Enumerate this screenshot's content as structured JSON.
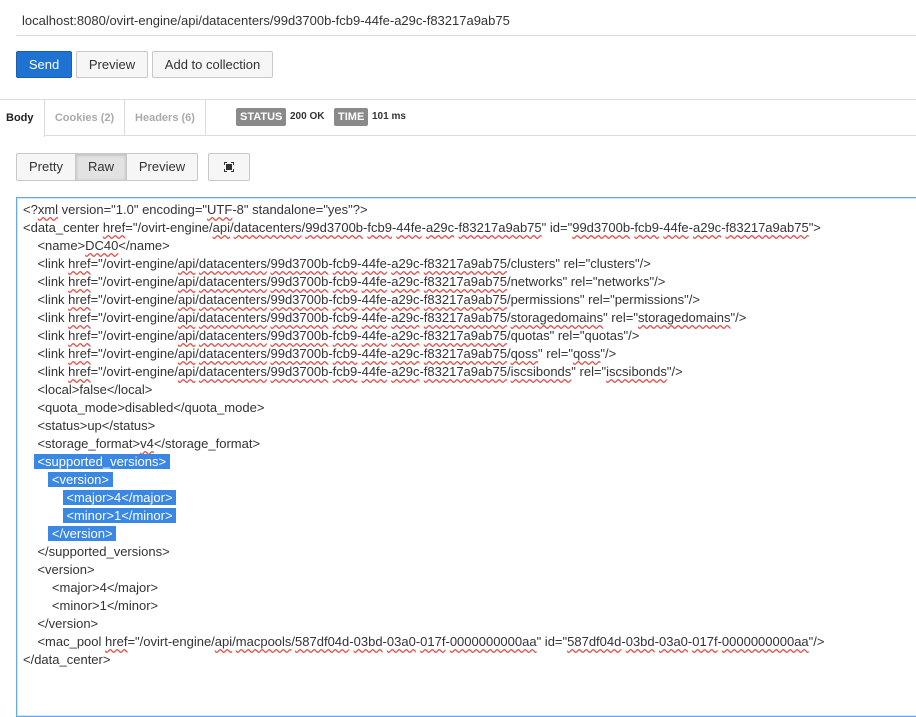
{
  "url": "localhost:8080/ovirt-engine/api/datacenters/99d3700b-fcb9-44fe-a29c-f83217a9ab75",
  "buttons": {
    "send": "Send",
    "preview": "Preview",
    "add_to_collection": "Add to collection"
  },
  "response_tabs": {
    "body": "Body",
    "cookies": "Cookies (2)",
    "headers": "Headers (6)"
  },
  "status": {
    "status_label": "STATUS",
    "status_value": "200 OK",
    "time_label": "TIME",
    "time_value": "101 ms"
  },
  "view_modes": {
    "pretty": "Pretty",
    "raw": "Raw",
    "preview": "Preview",
    "selected": "Raw"
  },
  "icons": {
    "expand": "expand-icon"
  },
  "colors": {
    "send_button": "#1e73d2",
    "selection": "#3a88e3",
    "focus_border": "#66aaee",
    "spell_underline": "#e0504a"
  },
  "body_lines": [
    "<?xml version=\"1.0\" encoding=\"UTF-8\" standalone=\"yes\"?>",
    "<data_center href=\"/ovirt-engine/api/datacenters/99d3700b-fcb9-44fe-a29c-f83217a9ab75\" id=\"99d3700b-fcb9-44fe-a29c-f83217a9ab75\">",
    "    <name>DC40</name>",
    "    <link href=\"/ovirt-engine/api/datacenters/99d3700b-fcb9-44fe-a29c-f83217a9ab75/clusters\" rel=\"clusters\"/>",
    "    <link href=\"/ovirt-engine/api/datacenters/99d3700b-fcb9-44fe-a29c-f83217a9ab75/networks\" rel=\"networks\"/>",
    "    <link href=\"/ovirt-engine/api/datacenters/99d3700b-fcb9-44fe-a29c-f83217a9ab75/permissions\" rel=\"permissions\"/>",
    "    <link href=\"/ovirt-engine/api/datacenters/99d3700b-fcb9-44fe-a29c-f83217a9ab75/storagedomains\" rel=\"storagedomains\"/>",
    "    <link href=\"/ovirt-engine/api/datacenters/99d3700b-fcb9-44fe-a29c-f83217a9ab75/quotas\" rel=\"quotas\"/>",
    "    <link href=\"/ovirt-engine/api/datacenters/99d3700b-fcb9-44fe-a29c-f83217a9ab75/qoss\" rel=\"qoss\"/>",
    "    <link href=\"/ovirt-engine/api/datacenters/99d3700b-fcb9-44fe-a29c-f83217a9ab75/iscsibonds\" rel=\"iscsibonds\"/>",
    "    <local>false</local>",
    "    <quota_mode>disabled</quota_mode>",
    "    <status>up</status>",
    "    <storage_format>v4</storage_format>",
    "    <supported_versions>",
    "        <version>",
    "            <major>4</major>",
    "            <minor>1</minor>",
    "        </version>",
    "    </supported_versions>",
    "    <version>",
    "        <major>4</major>",
    "        <minor>1</minor>",
    "    </version>",
    "    <mac_pool href=\"/ovirt-engine/api/macpools/587df04d-03bd-03a0-017f-0000000000aa\" id=\"587df04d-03bd-03a0-017f-0000000000aa\"/>",
    "</data_center>"
  ],
  "selected_lines": [
    14,
    15,
    16,
    17,
    18
  ],
  "spellcheck_words": [
    "xml",
    "UTF",
    "href",
    "api",
    "datacenters",
    "99d3700b",
    "fcb9",
    "44fe",
    "a29c",
    "f83217a9ab75",
    "DC40",
    "storagedomains",
    "qoss",
    "iscsibonds",
    "v4",
    "macpools",
    "587df04d",
    "03bd",
    "03a0",
    "017f",
    "0000000000aa"
  ]
}
